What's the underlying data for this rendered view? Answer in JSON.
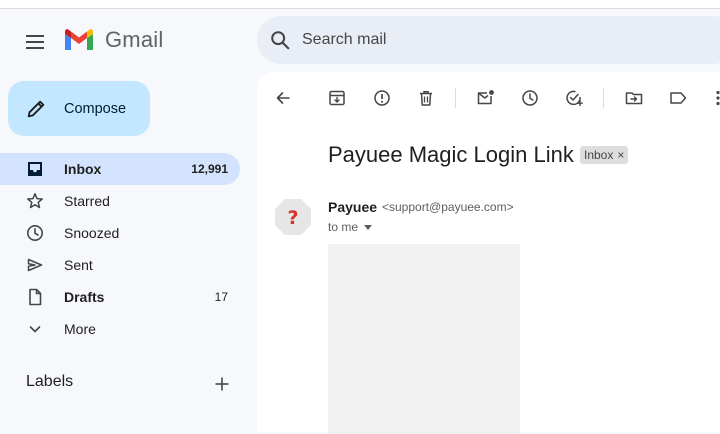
{
  "app": {
    "name": "Gmail"
  },
  "search": {
    "placeholder": "Search mail"
  },
  "compose": {
    "label": "Compose"
  },
  "sidebar": {
    "items": [
      {
        "label": "Inbox",
        "count": "12,991",
        "icon": "inbox-icon",
        "active": true
      },
      {
        "label": "Starred",
        "count": "",
        "icon": "star-icon"
      },
      {
        "label": "Snoozed",
        "count": "",
        "icon": "clock-icon"
      },
      {
        "label": "Sent",
        "count": "",
        "icon": "send-icon"
      },
      {
        "label": "Drafts",
        "count": "17",
        "icon": "draft-icon"
      },
      {
        "label": "More",
        "count": "",
        "icon": "chevron-down-icon"
      }
    ],
    "labels_title": "Labels"
  },
  "message": {
    "subject": "Payuee Magic Login Link",
    "label_badge": "Inbox",
    "badge_close": "×",
    "sender_name": "Payuee",
    "sender_email": "<support@payuee.com>",
    "recipient": "to me"
  },
  "colors": {
    "background": "#f6f8fc",
    "compose": "#c2e7ff",
    "active_nav": "#d3e3fd",
    "search": "#e9eef6"
  }
}
